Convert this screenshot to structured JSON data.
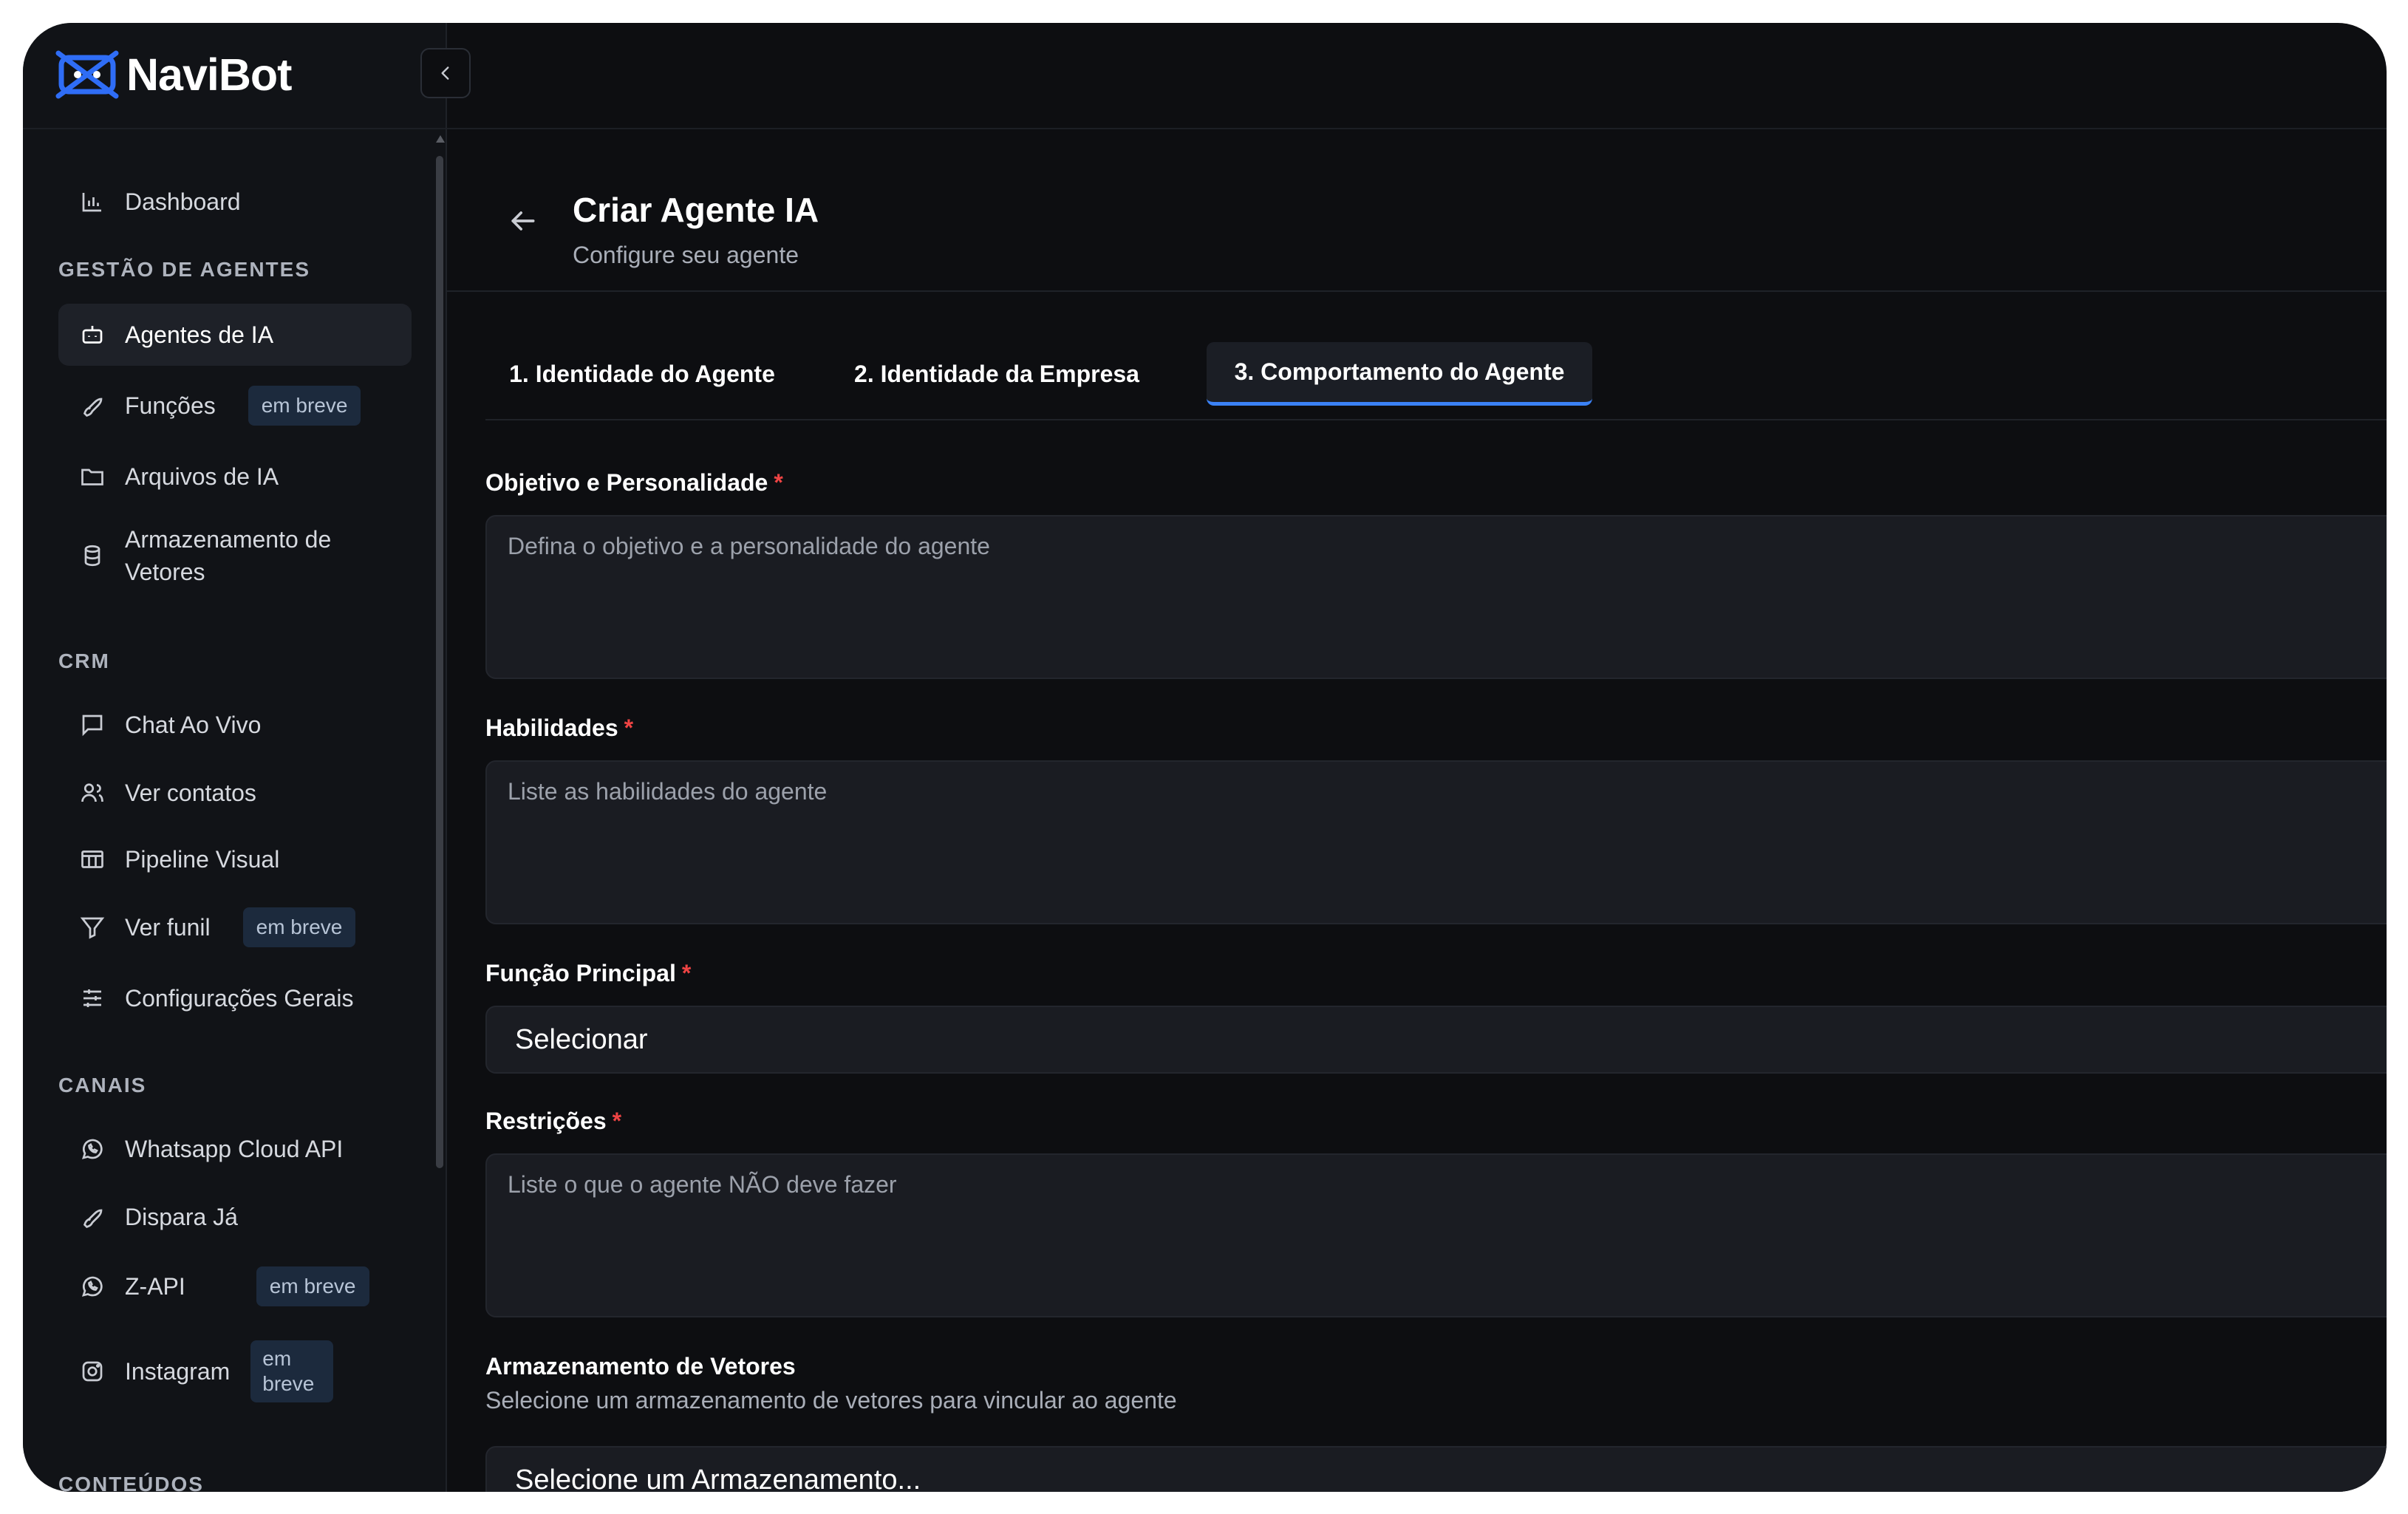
{
  "brand": {
    "name": "NaviBot"
  },
  "sidebar": {
    "dashboard": "Dashboard",
    "sections": {
      "agents": "GESTÃO DE AGENTES",
      "crm": "CRM",
      "channels": "CANAIS",
      "contents": "CONTEÚDOS"
    },
    "items": {
      "agentes_ia": "Agentes de IA",
      "funcoes": "Funções",
      "arquivos": "Arquivos de IA",
      "armazenamento": "Armazenamento de Vetores",
      "chat": "Chat Ao Vivo",
      "contatos": "Ver contatos",
      "pipeline": "Pipeline Visual",
      "funil": "Ver funil",
      "config": "Configurações Gerais",
      "whatsapp": "Whatsapp Cloud API",
      "dispara": "Dispara Já",
      "zapi": "Z-API",
      "instagram": "Instagram"
    },
    "badge_soon": "em breve"
  },
  "header": {
    "title": "Criar Agente IA",
    "subtitle": "Configure seu agente"
  },
  "tabs": [
    {
      "label": "1. Identidade do Agente",
      "active": false
    },
    {
      "label": "2. Identidade da Empresa",
      "active": false
    },
    {
      "label": "3. Comportamento do Agente",
      "active": true
    }
  ],
  "form": {
    "objetivo": {
      "label": "Objetivo e Personalidade",
      "placeholder": "Defina o objetivo e a personalidade do agente"
    },
    "habilidades": {
      "label": "Habilidades",
      "placeholder": "Liste as habilidades do agente"
    },
    "funcao": {
      "label": "Função Principal",
      "value": "Selecionar"
    },
    "restricoes": {
      "label": "Restrições",
      "placeholder": "Liste o que o agente NÃO deve fazer"
    },
    "vetores": {
      "label": "Armazenamento de Vetores",
      "description": "Selecione um armazenamento de vetores para vincular ao agente",
      "value": "Selecione um Armazenamento..."
    },
    "required_mark": "*"
  },
  "colors": {
    "background": "#0d0e11",
    "sidebar": "#111317",
    "accent": "#3b82f6",
    "required": "#ef4444",
    "brand_blue": "#2f6df6"
  }
}
